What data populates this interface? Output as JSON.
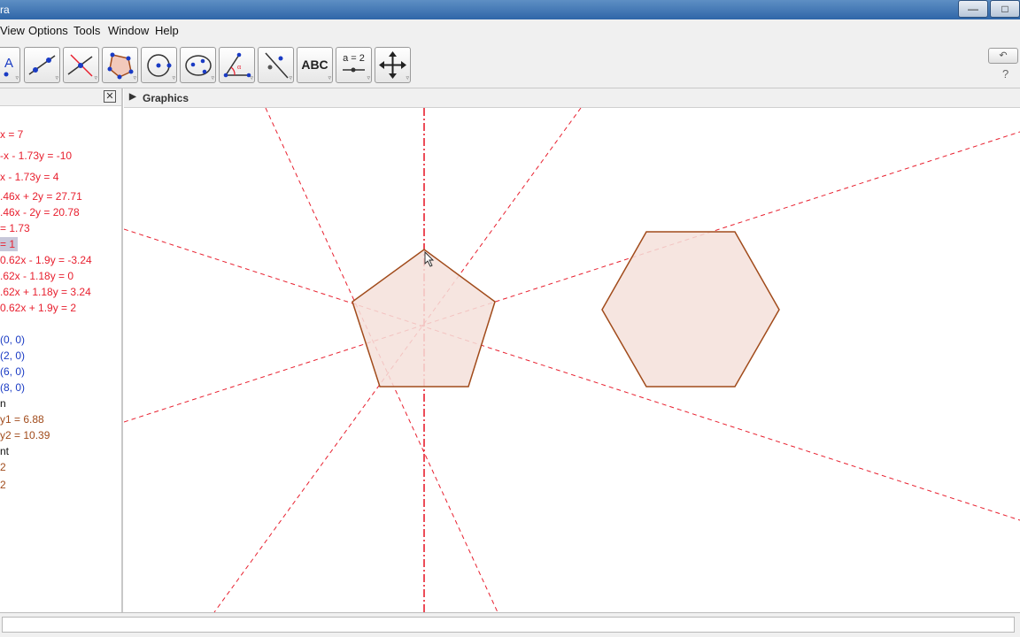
{
  "window": {
    "title": "ra"
  },
  "menu": [
    "View",
    "Options",
    "Tools",
    "Window",
    "Help"
  ],
  "toolbar": {
    "text_tool_label": "ABC",
    "slider_label": "a = 2"
  },
  "algebra_view": {
    "rows": [
      {
        "text": "x = 7",
        "color": "#e8202f"
      },
      {
        "text": "-x - 1.73y = -10",
        "color": "#e8202f"
      },
      {
        "text": "x - 1.73y = 4",
        "color": "#e8202f"
      },
      {
        "text": ".46x + 2y = 27.71",
        "color": "#e8202f"
      },
      {
        "text": ".46x - 2y = 20.78",
        "color": "#e8202f"
      },
      {
        "text": "= 1.73",
        "color": "#e8202f"
      },
      {
        "text": "= 1",
        "color": "#e8202f",
        "selected": true
      },
      {
        "text": "0.62x - 1.9y = -3.24",
        "color": "#e8202f"
      },
      {
        "text": ".62x - 1.18y = 0",
        "color": "#e8202f"
      },
      {
        "text": ".62x + 1.18y = 3.24",
        "color": "#e8202f"
      },
      {
        "text": "0.62x + 1.9y = 2",
        "color": "#e8202f"
      },
      {
        "text": "(0, 0)",
        "color": "#1a3bc4"
      },
      {
        "text": "(2, 0)",
        "color": "#1a3bc4"
      },
      {
        "text": "(6, 0)",
        "color": "#1a3bc4"
      },
      {
        "text": "(8, 0)",
        "color": "#1a3bc4"
      },
      {
        "text": "n",
        "color": "#111111"
      },
      {
        "text": "y1 = 6.88",
        "color": "#a14b1b"
      },
      {
        "text": "y2 = 10.39",
        "color": "#a14b1b"
      },
      {
        "text": "nt",
        "color": "#111111"
      },
      {
        "text": "2",
        "color": "#a14b1b"
      },
      {
        "text": "2",
        "color": "#a14b1b"
      }
    ]
  },
  "graphics_view": {
    "title": "Graphics",
    "line_color": "#e8202f",
    "polygon_stroke": "#a14b1b",
    "polygon_fill": "#f4e1db"
  },
  "input_bar": {
    "value": ""
  }
}
